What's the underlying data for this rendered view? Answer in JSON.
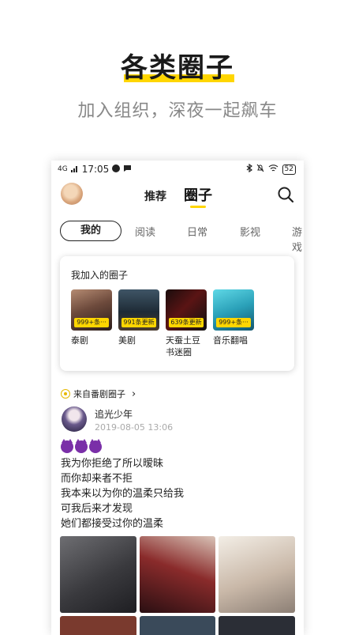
{
  "promo": {
    "title": "各类圈子",
    "subtitle": "加入组织，深夜一起飙车"
  },
  "statusbar": {
    "signal": "4G",
    "time": "17:05",
    "battery": "52"
  },
  "topnav": {
    "tab_recommend": "推荐",
    "tab_circle": "圈子",
    "accent": "#ffd600"
  },
  "categories": {
    "active": "我的",
    "items": [
      "阅读",
      "日常",
      "影视",
      "游戏"
    ]
  },
  "my_circles": {
    "title": "我加入的圈子",
    "items": [
      {
        "name": "泰剧",
        "badge": "999+条···"
      },
      {
        "name": "美剧",
        "badge": "991条更新"
      },
      {
        "name": "天蚕土豆\n书迷圈",
        "badge": "639条更新"
      },
      {
        "name": "音乐翻唱",
        "badge": "999+条···"
      }
    ]
  },
  "post": {
    "from_label": "来自番剧圈子",
    "from_arrow": "›",
    "user": "追光少年",
    "time": "2019-08-05 13:06",
    "lines": [
      "我为你拒绝了所以暧昧",
      "而你却来者不拒",
      "我本来以为你的温柔只给我",
      "可我后来才发现",
      "她们都接受过你的温柔"
    ]
  }
}
